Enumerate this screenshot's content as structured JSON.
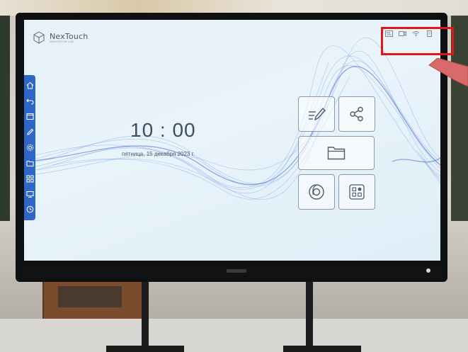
{
  "brand": {
    "name": "NexTouch",
    "tagline": "INNOVATION LAB"
  },
  "clock": {
    "time": "10 : 00",
    "date": "пятница, 15 декабря 2023 г."
  },
  "status_bar": {
    "icons": [
      "keyboard-icon",
      "camera-icon",
      "wifi-icon",
      "file-icon"
    ]
  },
  "sidebar": {
    "icons": [
      "home-icon",
      "back-icon",
      "window-icon",
      "pen-icon",
      "settings-icon",
      "folder-icon",
      "apps-icon",
      "display-icon",
      "clock-icon"
    ]
  },
  "tiles": [
    {
      "name": "whiteboard-tile",
      "icon": "whiteboard-pen-icon"
    },
    {
      "name": "share-tile",
      "icon": "share-icon"
    },
    {
      "name": "files-tile",
      "icon": "folder-icon"
    },
    {
      "name": "browser-tile",
      "icon": "browser-icon"
    },
    {
      "name": "apps-tile",
      "icon": "apps-grid-icon"
    }
  ],
  "colors": {
    "accent": "#2f67c9",
    "callout": "#e0161b",
    "wave": "#3a6fd6"
  }
}
